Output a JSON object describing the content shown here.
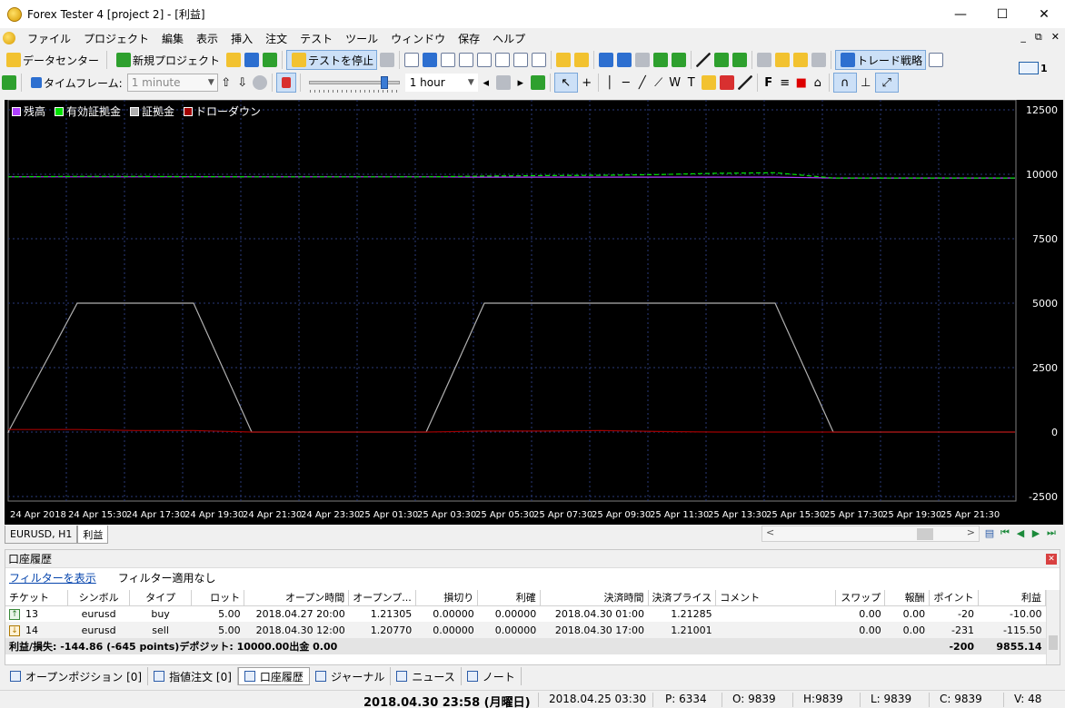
{
  "window": {
    "title": "Forex Tester 4  [project 2] - [利益]",
    "minimize": "—",
    "maximize": "☐",
    "close": "✕"
  },
  "menu": {
    "items": [
      "ファイル",
      "プロジェクト",
      "編集",
      "表示",
      "挿入",
      "注文",
      "テスト",
      "ツール",
      "ウィンドウ",
      "保存",
      "ヘルプ"
    ],
    "mdi_min": "_",
    "mdi_restore": "⧉",
    "mdi_close": "✕"
  },
  "toolbar": {
    "data_center": "データセンター",
    "new_project": "新規プロジェクト",
    "stop_test": "テストを停止",
    "trade_strategy": "トレード戦略",
    "timeframe_label": "タイムフレーム:",
    "timeframe_value": "1 minute",
    "speed_value": "1 hour",
    "font_btn": "F",
    "text_tool": "T",
    "wave_tool": "W"
  },
  "mail": {
    "count": "1"
  },
  "chart": {
    "legend": [
      {
        "label": "残高",
        "color": "#b040ff"
      },
      {
        "label": "有効証拠金",
        "color": "#00e000"
      },
      {
        "label": "証拠金",
        "color": "#b0b0b0"
      },
      {
        "label": "ドローダウン",
        "color": "#a00000"
      }
    ]
  },
  "chart_data": {
    "type": "line",
    "title": "",
    "xlabel": "",
    "ylabel": "",
    "ylim": [
      -2500,
      12500
    ],
    "y_ticks": [
      "12500",
      "10000",
      "7500",
      "5000",
      "2500",
      "0",
      "-2500"
    ],
    "x_ticks": [
      "24 Apr 2018",
      "24 Apr 15:30",
      "24 Apr 17:30",
      "24 Apr 19:30",
      "24 Apr 21:30",
      "24 Apr 23:30",
      "25 Apr 01:30",
      "25 Apr 03:30",
      "25 Apr 05:30",
      "25 Apr 07:30",
      "25 Apr 09:30",
      "25 Apr 11:30",
      "25 Apr 13:30",
      "25 Apr 15:30",
      "25 Apr 17:30",
      "25 Apr 19:30",
      "25 Apr 21:30"
    ],
    "grid": true,
    "legend_position": "top-left",
    "series": [
      {
        "name": "残高",
        "color": "#b040ff",
        "values": [
          9900,
          9900,
          9900,
          9900,
          9900,
          9900,
          9900,
          9900,
          9890,
          9890,
          9890,
          9890,
          9890,
          9890,
          9855,
          9855,
          9855
        ]
      },
      {
        "name": "有効証拠金",
        "color": "#00e000",
        "values": [
          9900,
          9920,
          9920,
          9910,
          9900,
          9900,
          9900,
          9900,
          9930,
          9950,
          9960,
          9990,
          10040,
          10060,
          9855,
          9855,
          9855
        ]
      },
      {
        "name": "証拠金",
        "color": "#b0b0b0",
        "values": [
          0,
          5000,
          5000,
          5000,
          0,
          0,
          0,
          0,
          5000,
          5000,
          5000,
          5000,
          5000,
          5000,
          0,
          0,
          0
        ]
      },
      {
        "name": "ドローダウン",
        "color": "#a00000",
        "values": [
          100,
          100,
          60,
          60,
          0,
          0,
          0,
          0,
          40,
          40,
          60,
          20,
          0,
          0,
          0,
          0,
          0
        ]
      }
    ]
  },
  "chart_tabs": [
    "EURUSD, H1",
    "利益"
  ],
  "history": {
    "title": "口座履歴",
    "filter_link": "フィルターを表示",
    "filter_status": "フィルター適用なし",
    "columns": [
      "チケット",
      "シンボル",
      "タイプ",
      "ロット",
      "オープン時間",
      "オープンプ...",
      "損切り",
      "利確",
      "決済時間",
      "決済プライス",
      "コメント",
      "スワップ",
      "報酬",
      "ポイント",
      "利益"
    ],
    "rows": [
      {
        "ticket": "13",
        "symbol": "eurusd",
        "type": "buy",
        "lot": "5.00",
        "open_time": "2018.04.27 20:00",
        "open_price": "1.21305",
        "sl": "0.00000",
        "tp": "0.00000",
        "close_time": "2018.04.30 01:00",
        "close_price": "1.21285",
        "comment": "",
        "swap": "0.00",
        "commission": "0.00",
        "points": "-20",
        "profit": "-10.00"
      },
      {
        "ticket": "14",
        "symbol": "eurusd",
        "type": "sell",
        "lot": "5.00",
        "open_time": "2018.04.30 12:00",
        "open_price": "1.20770",
        "sl": "0.00000",
        "tp": "0.00000",
        "close_time": "2018.04.30 17:00",
        "close_price": "1.21001",
        "comment": "",
        "swap": "0.00",
        "commission": "0.00",
        "points": "-231",
        "profit": "-115.50"
      }
    ],
    "summary": {
      "text": "利益/損失: -144.86 (-645 points)デポジット: 10000.00出金 0.00",
      "points": "-200",
      "profit": "9855.14"
    }
  },
  "bottom_tabs": [
    "オープンポジション [0]",
    "指値注文 [0]",
    "口座履歴",
    "ジャーナル",
    "ニュース",
    "ノート"
  ],
  "status": {
    "datetime": "2018.04.30 23:58 (月曜日)",
    "bar_time": "2018.04.25 03:30",
    "p": "P: 6334",
    "o": "O: 9839",
    "h": "H:9839",
    "l": "L: 9839",
    "c": "C: 9839",
    "v": "V: 48"
  }
}
